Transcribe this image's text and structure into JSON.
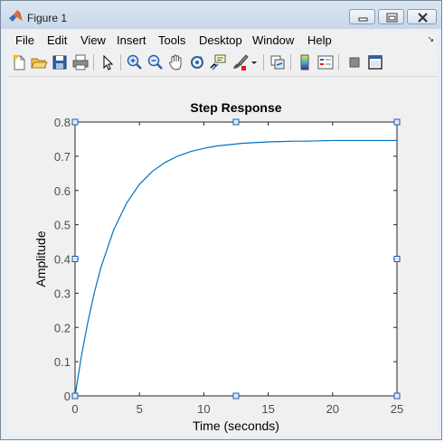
{
  "window": {
    "title": "Figure 1",
    "buttons": [
      "minimize",
      "maximize",
      "close"
    ]
  },
  "menu": {
    "items": [
      "File",
      "Edit",
      "View",
      "Insert",
      "Tools",
      "Desktop",
      "Window",
      "Help"
    ],
    "overflow_icon": "arrow-icon"
  },
  "toolbar": {
    "icons": [
      "new-figure-icon",
      "open-file-icon",
      "save-icon",
      "print-icon",
      "edit-plot-icon",
      "zoom-in-icon",
      "zoom-out-icon",
      "pan-icon",
      "rotate-3d-icon",
      "data-cursor-icon",
      "brush-icon",
      "brush-dropdown-icon",
      "link-plot-icon",
      "colorbar-icon",
      "legend-icon",
      "hide-plot-tools-icon",
      "show-plot-tools-icon"
    ]
  },
  "chart_data": {
    "type": "line",
    "title": "Step Response",
    "xlabel": "Time (seconds)",
    "ylabel": "Amplitude",
    "xlim": [
      0,
      25
    ],
    "ylim": [
      0,
      0.8
    ],
    "xticks": [
      "0",
      "5",
      "10",
      "15",
      "20",
      "25"
    ],
    "yticks": [
      "0",
      "0.1",
      "0.2",
      "0.3",
      "0.4",
      "0.5",
      "0.6",
      "0.7",
      "0.8"
    ],
    "steady_state": 0.8,
    "series": [
      {
        "color": "#0072bd",
        "x": [
          0,
          0.5,
          1,
          1.5,
          2,
          3,
          4,
          5,
          6,
          7,
          8,
          9,
          10,
          11,
          12,
          13,
          14,
          15,
          16,
          17,
          18,
          19,
          20,
          21,
          22,
          23,
          24,
          25
        ],
        "y": [
          0,
          0.118,
          0.217,
          0.302,
          0.374,
          0.485,
          0.563,
          0.618,
          0.656,
          0.682,
          0.701,
          0.714,
          0.723,
          0.73,
          0.734,
          0.738,
          0.74,
          0.742,
          0.743,
          0.744,
          0.744,
          0.745,
          0.746,
          0.746,
          0.746,
          0.746,
          0.746,
          0.746
        ]
      }
    ],
    "selection_handles": true,
    "grid": false
  }
}
